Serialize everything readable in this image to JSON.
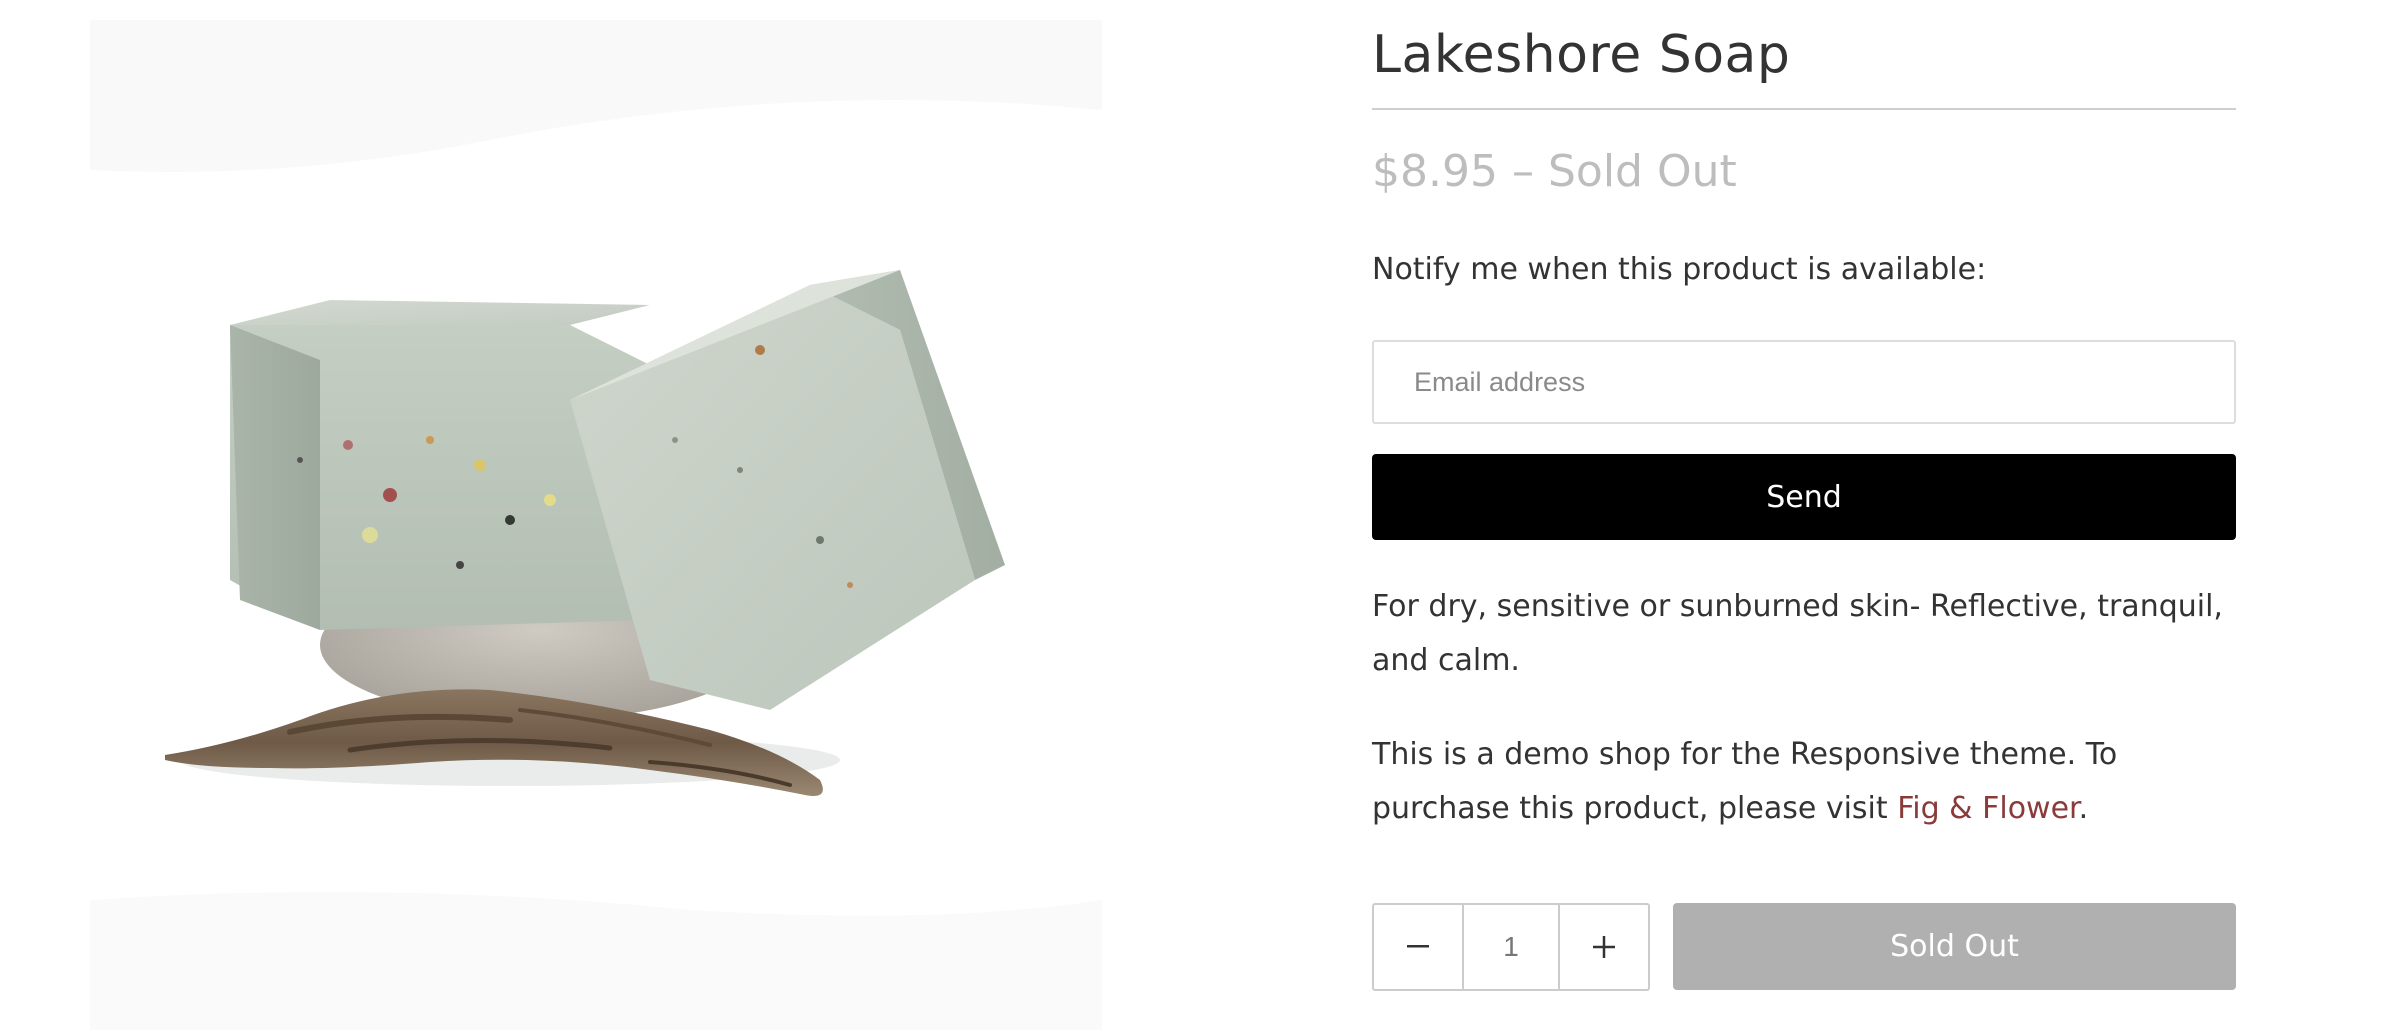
{
  "product": {
    "image_alt": "Two sage green soap bars on a grey pebble with driftwood",
    "title": "Lakeshore Soap",
    "price": "$8.95",
    "price_separator": "–",
    "status": "Sold Out"
  },
  "notify": {
    "label": "Notify me when this product is available:",
    "email_placeholder": "Email address",
    "send_label": "Send"
  },
  "description": {
    "paragraph1": "For dry, sensitive or sunburned skin- Reflective, tranquil, and calm.",
    "paragraph2_text": "This is a demo shop for the Responsive theme. To purchase this product, please visit ",
    "paragraph2_link": "Fig & Flower",
    "paragraph2_end": "."
  },
  "purchase": {
    "decrement_icon": "minus-icon",
    "increment_icon": "plus-icon",
    "quantity": "1",
    "button_label": "Sold Out"
  },
  "colors": {
    "link": "#8b3a3a",
    "send_bg": "#000000",
    "soldout_bg": "#b0b0b0",
    "price": "#bdbdbd"
  }
}
